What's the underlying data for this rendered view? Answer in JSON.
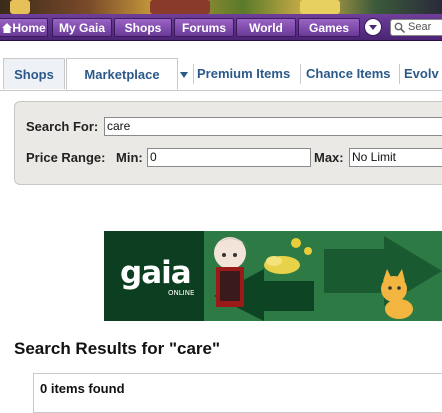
{
  "nav": {
    "items": [
      {
        "label": "Home"
      },
      {
        "label": "My Gaia"
      },
      {
        "label": "Shops"
      },
      {
        "label": "Forums"
      },
      {
        "label": "World"
      },
      {
        "label": "Games"
      }
    ],
    "search_placeholder": "Sear"
  },
  "tabs": [
    {
      "label": "Shops"
    },
    {
      "label": "Marketplace"
    },
    {
      "label": "Premium Items"
    },
    {
      "label": "Chance Items"
    },
    {
      "label": "Evolv"
    }
  ],
  "search": {
    "search_for_label": "Search For:",
    "search_for_value": "care",
    "price_range_label": "Price Range:",
    "min_label": "Min:",
    "min_value": "0",
    "max_label": "Max:",
    "max_value": "No Limit"
  },
  "ad": {
    "logo_text": "gaia",
    "logo_sub": "ONLINE"
  },
  "results": {
    "title": "Search Results for \"care\"",
    "count": "0 items found"
  },
  "colors": {
    "nav_purple": "#5a2d86",
    "tab_text": "#2b5a8a",
    "panel_bg": "#ebe9e6",
    "ad_green": "#2e7a44"
  }
}
